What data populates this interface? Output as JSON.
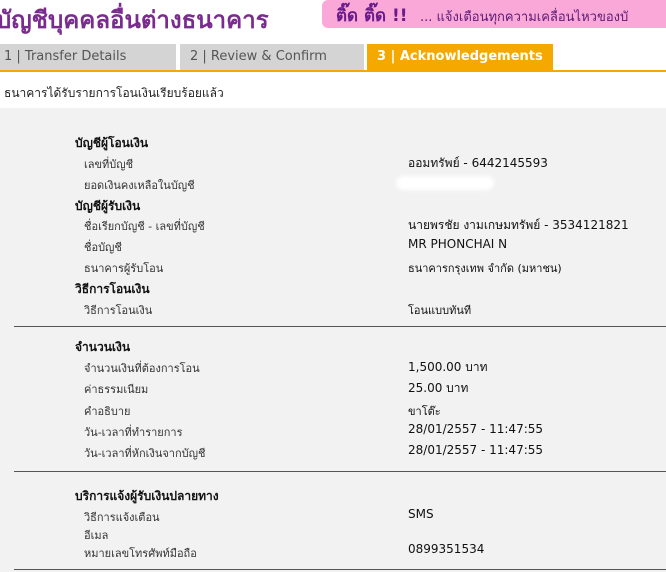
{
  "header": {
    "title": "บัญชีบุคคลอื่นต่างธนาคาร",
    "alert_tag": "ติ๊ด ติ๊ด !!",
    "alert_text": "... แจ้งเตือนทุกความเคลื่อนไหวของบั"
  },
  "tabs": [
    {
      "label": "1 | Transfer Details"
    },
    {
      "label": "2 | Review & Confirm"
    },
    {
      "label": "3 | Acknowledgements"
    }
  ],
  "notice": "ธนาคารได้รับรายการโอนเงินเรียบร้อยแล้ว",
  "from_account": {
    "title": "บัญชีผู้โอนเงิน",
    "account_no_label": "เลขที่บัญชี",
    "account_no_value": "ออมทรัพย์ - 6442145593",
    "balance_label": "ยอดเงินคงเหลือในบัญชี"
  },
  "to_account": {
    "title": "บัญชีผู้รับเงิน",
    "alias_label": "ชื่อเรียกบัญชี - เลขที่บัญชี",
    "alias_value": "นายพรชัย งามเกษมทรัพย์ - 3534121821",
    "name_label": "ชื่อบัญชี",
    "name_value": "MR PHONCHAI N",
    "bank_label": "ธนาคารผู้รับโอน",
    "bank_value": "ธนาคารกรุงเทพ จำกัด (มหาชน)"
  },
  "method": {
    "title": "วิธีการโอนเงิน",
    "label": "วิธีการโอนเงิน",
    "value": "โอนแบบทันที"
  },
  "amount": {
    "title": "จำนวนเงิน",
    "amount_label": "จำนวนเงินที่ต้องการโอน",
    "amount_value": "1,500.00 บาท",
    "fee_label": "ค่าธรรมเนียม",
    "fee_value": "25.00  บาท",
    "desc_label": "คำอธิบาย",
    "desc_value": "ขาโต๊ะ",
    "txn_time_label": "วัน-เวลาที่ทำรายการ",
    "txn_time_value": "28/01/2557 - 11:47:55",
    "debit_time_label": "วัน-เวลาที่หักเงินจากบัญชี",
    "debit_time_value": "28/01/2557 - 11:47:55"
  },
  "notify": {
    "title": "บริการแจ้งผู้รับเงินปลายทาง",
    "method_label": "วิธีการแจ้งเตือน",
    "method_value": "SMS",
    "email_label": "อีเมล",
    "phone_label": "หมายเลขโทรศัพท์มือถือ",
    "phone_value": "0899351534"
  }
}
